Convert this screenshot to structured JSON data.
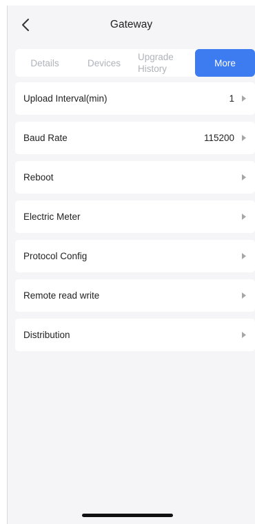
{
  "header": {
    "title": "Gateway",
    "back_icon": "chevron-left-icon"
  },
  "tabs": [
    {
      "label": "Details",
      "active": false
    },
    {
      "label": "Devices",
      "active": false
    },
    {
      "label": "Upgrade History",
      "line1": "Upgrade",
      "line2": "History",
      "active": false
    },
    {
      "label": "More",
      "active": true
    }
  ],
  "settings": [
    {
      "label": "Upload Interval(min)",
      "value": "1"
    },
    {
      "label": "Baud Rate",
      "value": "115200"
    },
    {
      "label": "Reboot",
      "value": ""
    },
    {
      "label": "Electric Meter",
      "value": ""
    },
    {
      "label": "Protocol Config",
      "value": ""
    },
    {
      "label": "Remote read write",
      "value": ""
    },
    {
      "label": "Distribution",
      "value": ""
    }
  ],
  "row_arrow_icon": "caret-right-icon",
  "colors": {
    "accent": "#3d7bf1",
    "background": "#f5f5f7",
    "inactive_tab_text": "#b0b3bb",
    "arrow": "#a6a6a6"
  }
}
